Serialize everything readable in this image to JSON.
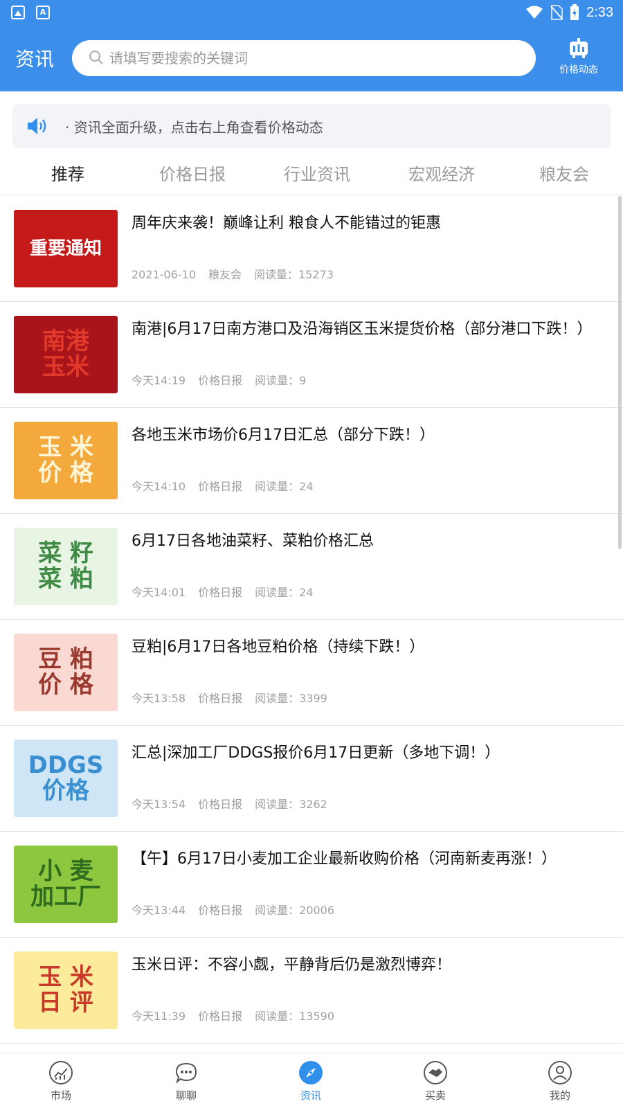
{
  "status_bar": {
    "time": "2:33"
  },
  "header": {
    "title": "资讯",
    "search_placeholder": "请填写要搜索的关键词",
    "price_button_label": "价格动态"
  },
  "notice": {
    "text": "· 资讯全面升级，点击右上角查看价格动态"
  },
  "tabs": [
    {
      "label": "推荐"
    },
    {
      "label": "价格日报"
    },
    {
      "label": "行业资讯"
    },
    {
      "label": "宏观经济"
    },
    {
      "label": "粮友会"
    }
  ],
  "articles": [
    {
      "title": "周年庆来袭！巅峰让利 粮食人不能错过的钜惠",
      "date": "2021-06-10",
      "category": "粮友会",
      "reads": "阅读量：15273",
      "thumb_lines": [
        "重要通知"
      ],
      "thumb_bg": "#c41a1a",
      "thumb_fg": "#ffffff"
    },
    {
      "title": "南港|6月17日南方港口及沿海销区玉米提货价格（部分港口下跌！）",
      "date": "今天14:19",
      "category": "价格日报",
      "reads": "阅读量：9",
      "thumb_lines": [
        "南港",
        "玉米"
      ],
      "thumb_bg": "#a8141a",
      "thumb_fg": "#e23a2a"
    },
    {
      "title": "各地玉米市场价6月17日汇总（部分下跌！）",
      "date": "今天14:10",
      "category": "价格日报",
      "reads": "阅读量：24",
      "thumb_lines": [
        "玉 米",
        "价 格"
      ],
      "thumb_bg": "#f4a93c",
      "thumb_fg": "#fff6d8"
    },
    {
      "title": "6月17日各地油菜籽、菜粕价格汇总",
      "date": "今天14:01",
      "category": "价格日报",
      "reads": "阅读量：24",
      "thumb_lines": [
        "菜 籽",
        "菜 粕"
      ],
      "thumb_bg": "#e8f5e4",
      "thumb_fg": "#3f8a45"
    },
    {
      "title": "豆粕|6月17日各地豆粕价格（持续下跌！）",
      "date": "今天13:58",
      "category": "价格日报",
      "reads": "阅读量：3399",
      "thumb_lines": [
        "豆 粕",
        "价 格"
      ],
      "thumb_bg": "#fbd9d3",
      "thumb_fg": "#9a3a2e"
    },
    {
      "title": "汇总|深加工厂DDGS报价6月17日更新（多地下调！）",
      "date": "今天13:54",
      "category": "价格日报",
      "reads": "阅读量：3262",
      "thumb_lines": [
        "DDGS",
        "价格"
      ],
      "thumb_bg": "#cfe6f7",
      "thumb_fg": "#3a8fd0"
    },
    {
      "title": "【午】6月17日小麦加工企业最新收购价格（河南新麦再涨！）",
      "date": "今天13:44",
      "category": "价格日报",
      "reads": "阅读量：20006",
      "thumb_lines": [
        "小 麦",
        "加工厂"
      ],
      "thumb_bg": "#8dc63f",
      "thumb_fg": "#2e6b1f"
    },
    {
      "title": "玉米日评：不容小觑，平静背后仍是激烈博弈！",
      "date": "今天11:39",
      "category": "价格日报",
      "reads": "阅读量：13590",
      "thumb_lines": [
        "玉 米",
        "日 评"
      ],
      "thumb_bg": "#fbeb9a",
      "thumb_fg": "#c8392a"
    }
  ],
  "bottom_nav": [
    {
      "label": "市场",
      "icon": "market-icon"
    },
    {
      "label": "聊聊",
      "icon": "chat-icon"
    },
    {
      "label": "资讯",
      "icon": "compass-icon",
      "active": true
    },
    {
      "label": "买卖",
      "icon": "handshake-icon"
    },
    {
      "label": "我的",
      "icon": "user-icon"
    }
  ],
  "colors": {
    "primary": "#3b8eea",
    "active_nav": "#2f8fea"
  }
}
